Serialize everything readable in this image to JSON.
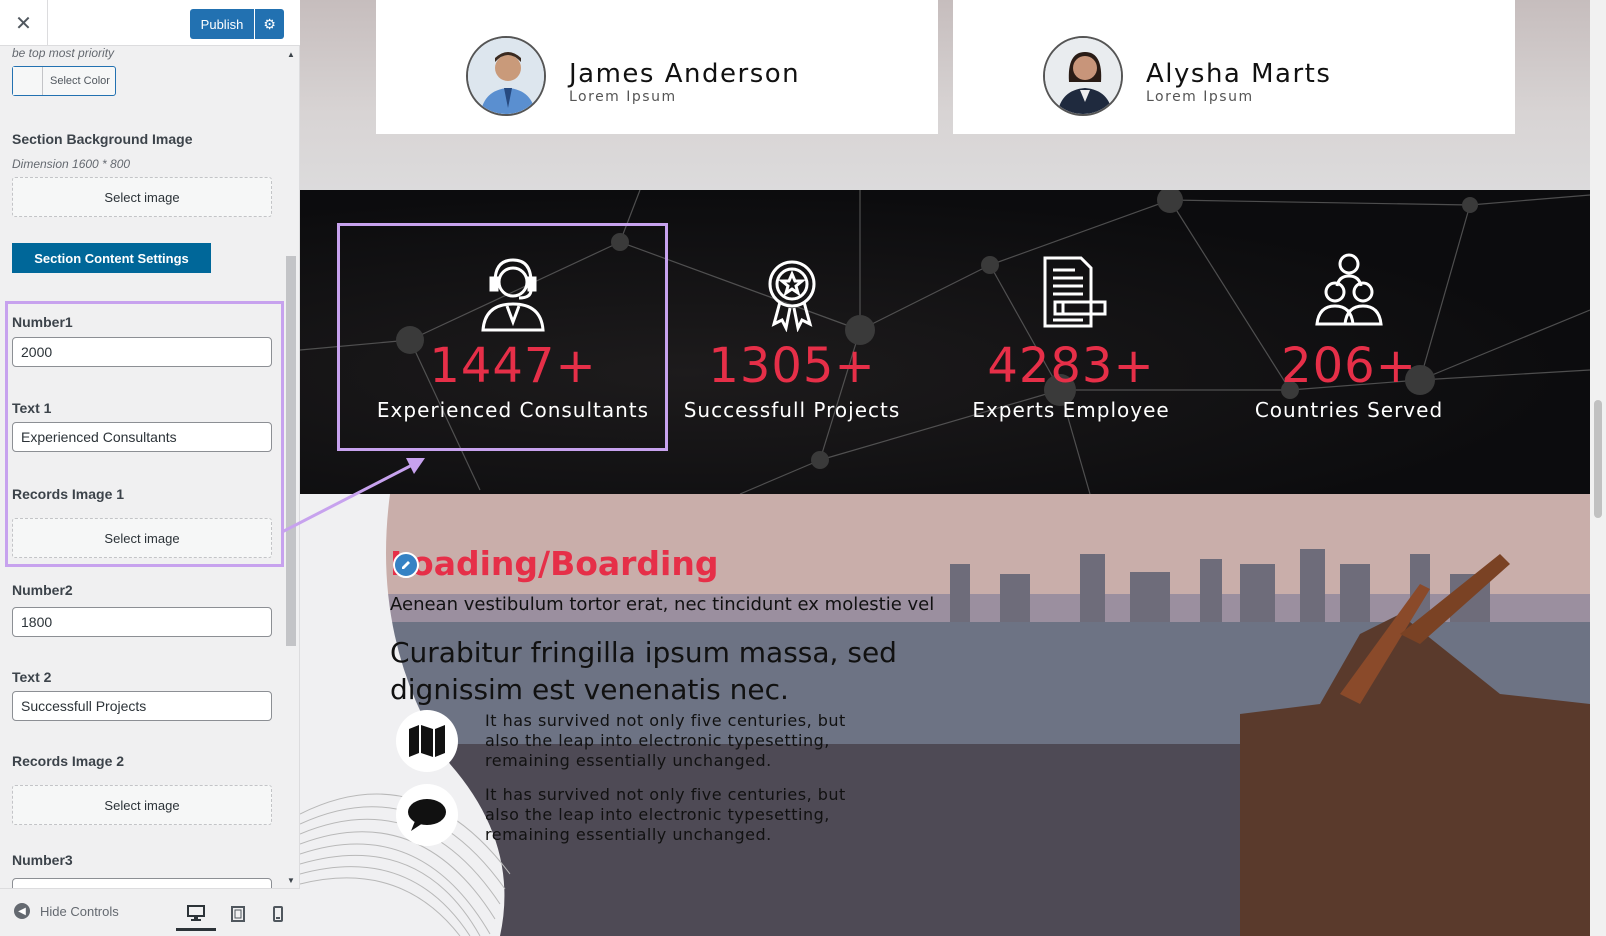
{
  "header": {
    "close_icon": "close-icon",
    "publish_label": "Publish",
    "settings_icon": "gear-icon"
  },
  "sidebar": {
    "priority_note": "be top most priority",
    "color_button_label": "Select Color",
    "bg_image_label": "Section Background Image",
    "bg_image_dimension": "Dimension 1600 * 800",
    "select_image_label": "Select image",
    "content_settings_label": "Section Content Settings",
    "number1_label": "Number1",
    "number1_value": "2000",
    "text1_label": "Text 1",
    "text1_value": "Experienced Consultants",
    "records_image1_label": "Records Image 1",
    "number2_label": "Number2",
    "number2_value": "1800",
    "text2_label": "Text 2",
    "text2_value": "Successfull Projects",
    "records_image2_label": "Records Image 2",
    "number3_label": "Number3"
  },
  "footer": {
    "hide_controls_label": "Hide Controls",
    "devices": [
      "desktop",
      "tablet",
      "mobile"
    ],
    "active_device": "desktop"
  },
  "preview": {
    "team": [
      {
        "name": "James Anderson",
        "role": "Lorem Ipsum"
      },
      {
        "name": "Alysha Marts",
        "role": "Lorem Ipsum"
      }
    ],
    "stats": [
      {
        "number": "1447+",
        "text": "Experienced Consultants",
        "icon": "headset-agent-icon"
      },
      {
        "number": "1305+",
        "text": "Successfull Projects",
        "icon": "award-badge-icon"
      },
      {
        "number": "4283+",
        "text": "Experts Employee",
        "icon": "document-pencil-icon"
      },
      {
        "number": "206+",
        "text": "Countries Served",
        "icon": "team-people-icon"
      }
    ],
    "about": {
      "title": "Loading/Boarding",
      "subtitle": "Aenean vestibulum tortor erat, nec tincidunt ex molestie vel",
      "heading": "Curabitur fringilla ipsum massa, sed dignissim est venenatis nec.",
      "features": [
        {
          "icon": "map-icon",
          "text": "It has survived not only five centuries, but also the leap into electronic typesetting, remaining essentially unchanged."
        },
        {
          "icon": "speech-bubble-icon",
          "text": "It has survived not only five centuries, but also the leap into electronic typesetting, remaining essentially unchanged."
        }
      ]
    }
  },
  "colors": {
    "accent": "#e62f48",
    "wp_blue": "#2271b1",
    "highlight": "#c7a2ee",
    "section_button": "#006799"
  }
}
